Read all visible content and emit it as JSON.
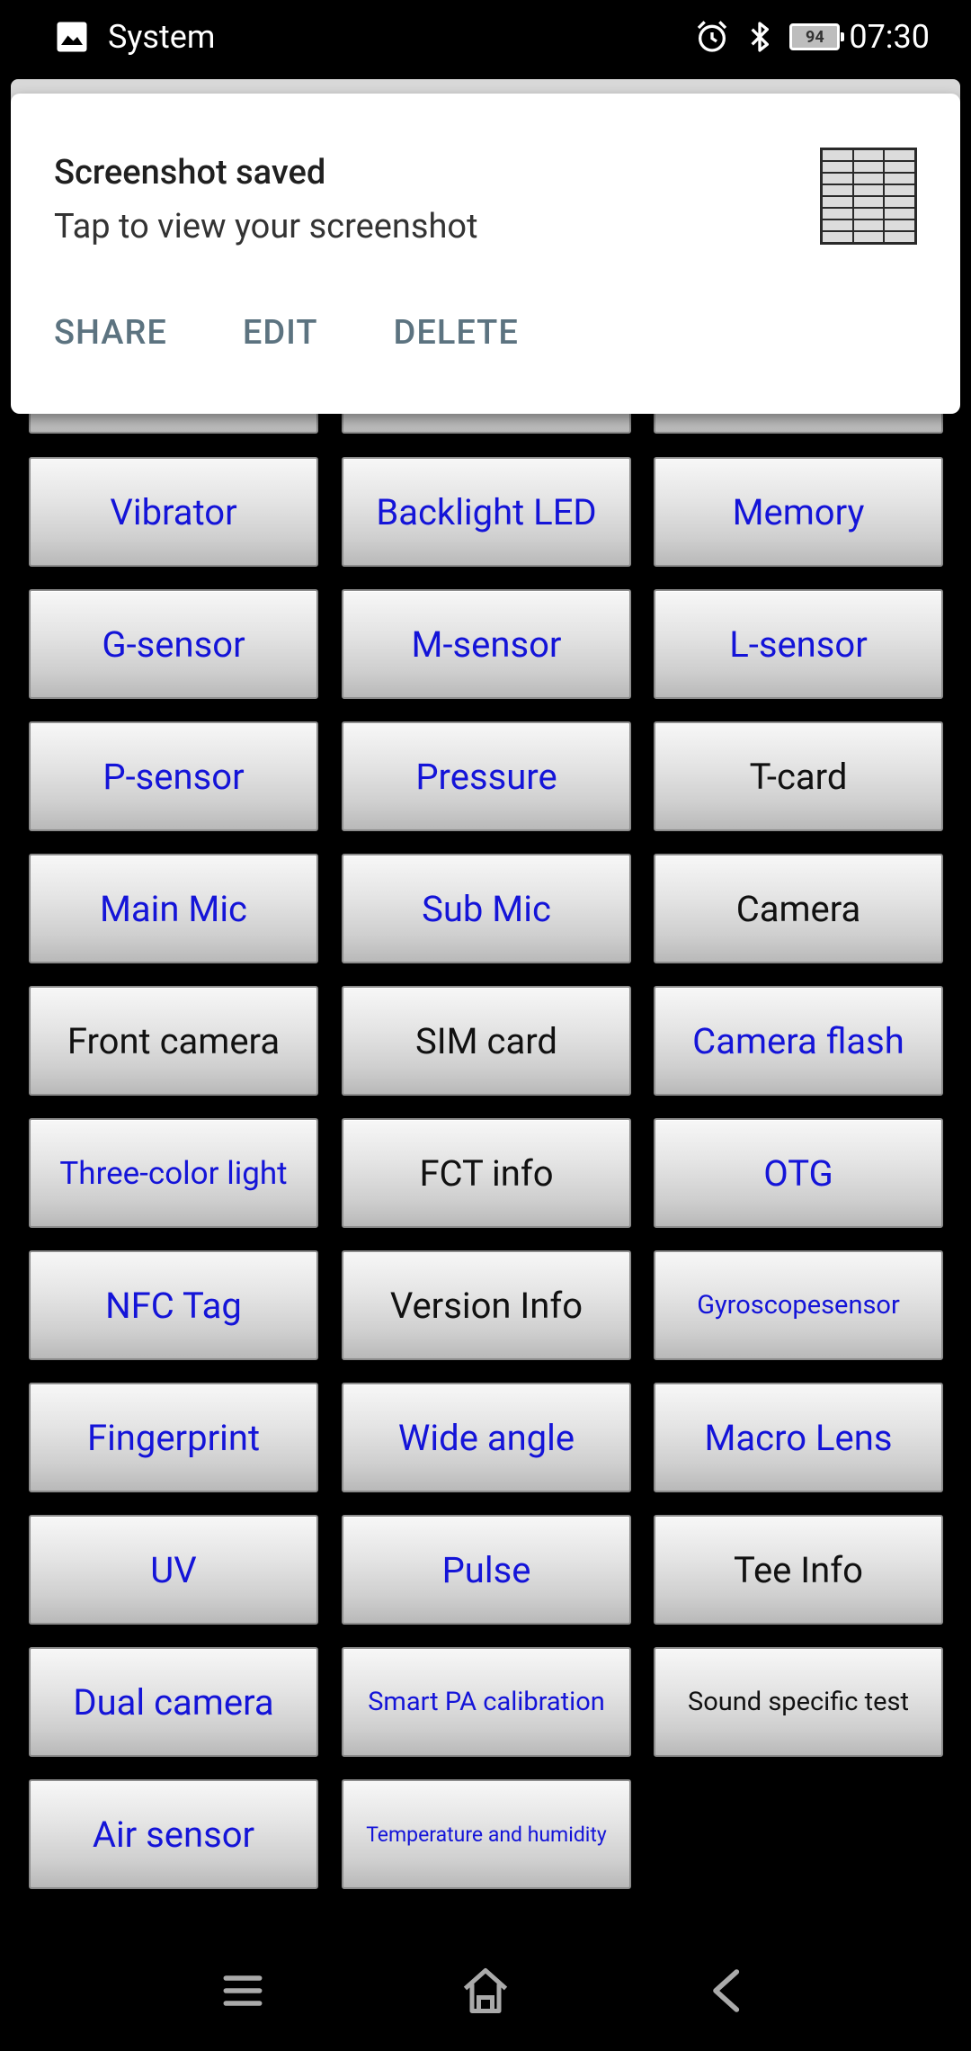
{
  "status_bar": {
    "app_icon": "image-icon",
    "app_name": "System",
    "alarm_icon": "alarm-icon",
    "bluetooth_icon": "bluetooth-icon",
    "battery_level": "94",
    "time": "07:30"
  },
  "notification": {
    "title": "Screenshot saved",
    "text": "Tap to view your screenshot",
    "actions": [
      "SHARE",
      "EDIT",
      "DELETE"
    ],
    "thumbnail": "screenshot-thumbnail"
  },
  "tests": {
    "rows": [
      [
        "Vibrator",
        "Backlight LED",
        "Memory"
      ],
      [
        "G-sensor",
        "M-sensor",
        "L-sensor"
      ],
      [
        "P-sensor",
        "Pressure",
        "T-card"
      ],
      [
        "Main Mic",
        "Sub Mic",
        "Camera"
      ],
      [
        "Front camera",
        "SIM card",
        "Camera flash"
      ],
      [
        "Three-color light",
        "FCT info",
        "OTG"
      ],
      [
        "NFC Tag",
        "Version Info",
        "Gyroscopesensor"
      ],
      [
        "Fingerprint",
        "Wide angle",
        "Macro Lens"
      ],
      [
        "UV",
        "Pulse",
        "Tee Info"
      ],
      [
        "Dual camera",
        "Smart PA calibration",
        "Sound specific test"
      ],
      [
        "Air sensor",
        "Temperature and humidity"
      ]
    ]
  },
  "colors": {
    "untested_text": "#1414d8",
    "tested_text": "#111111",
    "action_text": "#5c7380"
  },
  "nav_bar": {
    "menu_icon": "menu-icon",
    "home_icon": "home-icon",
    "back_icon": "back-icon"
  }
}
